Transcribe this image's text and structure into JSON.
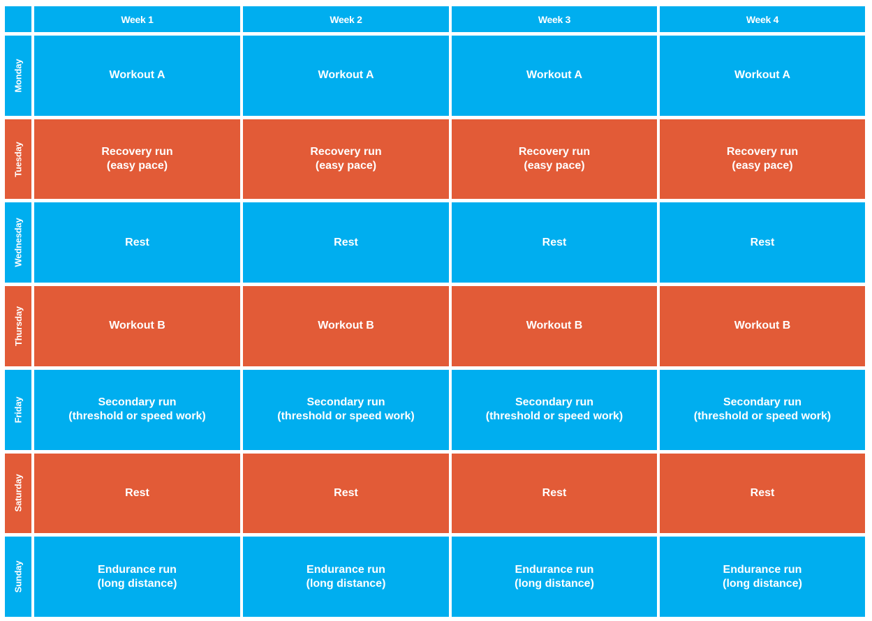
{
  "colors": {
    "blue": "#00AEEF",
    "orange": "#E25B37",
    "text": "#FFFFFF",
    "background": "#FFFFFF"
  },
  "corner": "",
  "weeks": [
    "Week 1",
    "Week 2",
    "Week 3",
    "Week 4"
  ],
  "days": [
    {
      "name": "Monday",
      "color": "blue",
      "lines": [
        "Workout A"
      ]
    },
    {
      "name": "Tuesday",
      "color": "orange",
      "lines": [
        "Recovery run",
        "(easy pace)"
      ]
    },
    {
      "name": "Wednesday",
      "color": "blue",
      "lines": [
        "Rest"
      ]
    },
    {
      "name": "Thursday",
      "color": "orange",
      "lines": [
        "Workout B"
      ]
    },
    {
      "name": "Friday",
      "color": "blue",
      "lines": [
        "Secondary run",
        "(threshold or speed work)"
      ]
    },
    {
      "name": "Saturday",
      "color": "orange",
      "lines": [
        "Rest"
      ]
    },
    {
      "name": "Sunday",
      "color": "blue",
      "lines": [
        "Endurance run",
        "(long distance)"
      ]
    }
  ],
  "schedule": [
    [
      [
        "Workout A"
      ],
      [
        "Workout A"
      ],
      [
        "Workout A"
      ],
      [
        "Workout A"
      ]
    ],
    [
      [
        "Recovery run",
        "(easy pace)"
      ],
      [
        "Recovery run",
        "(easy pace)"
      ],
      [
        "Recovery run",
        "(easy pace)"
      ],
      [
        "Recovery run",
        "(easy pace)"
      ]
    ],
    [
      [
        "Rest"
      ],
      [
        "Rest"
      ],
      [
        "Rest"
      ],
      [
        "Rest"
      ]
    ],
    [
      [
        "Workout B"
      ],
      [
        "Workout B"
      ],
      [
        "Workout B"
      ],
      [
        "Workout B"
      ]
    ],
    [
      [
        "Secondary run",
        "(threshold or speed work)"
      ],
      [
        "Secondary run",
        "(threshold or speed work)"
      ],
      [
        "Secondary run",
        "(threshold or speed work)"
      ],
      [
        "Secondary run",
        "(threshold or speed work)"
      ]
    ],
    [
      [
        "Rest"
      ],
      [
        "Rest"
      ],
      [
        "Rest"
      ],
      [
        "Rest"
      ]
    ],
    [
      [
        "Endurance run",
        "(long distance)"
      ],
      [
        "Endurance run",
        "(long distance)"
      ],
      [
        "Endurance run",
        "(long distance)"
      ],
      [
        "Endurance run",
        "(long distance)"
      ]
    ]
  ]
}
